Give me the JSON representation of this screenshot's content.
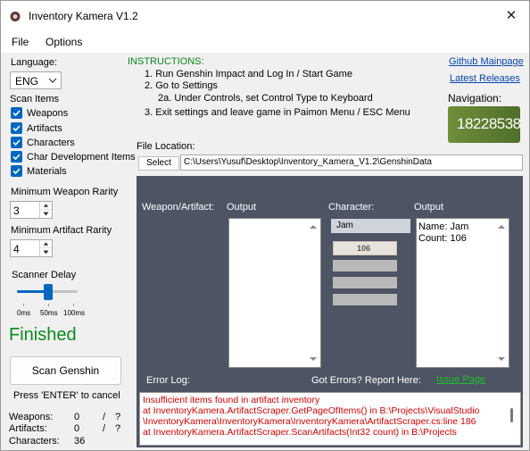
{
  "window": {
    "title": "Inventory Kamera V1.2",
    "close_symbol": "✕"
  },
  "menu": {
    "file": "File",
    "options": "Options"
  },
  "language": {
    "label": "Language:",
    "value": "ENG"
  },
  "scan_items": {
    "label": "Scan Items",
    "items": [
      {
        "label": "Weapons",
        "checked": true
      },
      {
        "label": "Artifacts",
        "checked": true
      },
      {
        "label": "Characters",
        "checked": true
      },
      {
        "label": "Char Development Items",
        "checked": true
      },
      {
        "label": "Materials",
        "checked": true
      }
    ]
  },
  "min_weapon_rarity": {
    "label": "Minimum Weapon Rarity",
    "value": "3"
  },
  "min_artifact_rarity": {
    "label": "Minimum Artifact Rarity",
    "value": "4"
  },
  "scanner_delay": {
    "label": "Scanner Delay",
    "ticks": [
      "0ms",
      "50ms",
      "100ms"
    ],
    "value_fraction": 0.5
  },
  "status": {
    "text": "Finished",
    "color": "#0a8a1e"
  },
  "scan_button": {
    "label": "Scan Genshin"
  },
  "cancel_hint": "Press 'ENTER' to cancel",
  "counts": {
    "weapons": {
      "label": "Weapons:",
      "value": "0",
      "sep": "/",
      "total": "?"
    },
    "artifacts": {
      "label": "Artifacts:",
      "value": "0",
      "sep": "/",
      "total": "?"
    },
    "characters": {
      "label": "Characters:",
      "value": "36"
    }
  },
  "instructions": {
    "title": "INSTRUCTIONS:",
    "lines": [
      "1. Run Genshin Impact and Log In / Start Game",
      "2. Go to Settings",
      "2a. Under Controls, set Control Type to Keyboard",
      "3. Exit settings and leave game in Paimon Menu / ESC Menu"
    ]
  },
  "links": {
    "github": "Github Mainpage",
    "releases": "Latest Releases"
  },
  "navigation": {
    "label": "Navigation:",
    "badge_text": "18228538"
  },
  "file_location": {
    "label": "File Location:",
    "select_label": "Select",
    "path": "C:\\Users\\Yusuf\\Desktop\\Inventory_Kamera_V1.2\\GenshinData"
  },
  "panel": {
    "weapon_artifact_label": "Weapon/Artifact:",
    "output_label_left": "Output",
    "character_label": "Character:",
    "output_label_right": "Output",
    "char_preview_name": "Jam",
    "char_preview_level": "106",
    "output_right_lines": [
      "Name: Jam",
      "Count: 106"
    ],
    "error_log_label": "Error Log:",
    "report_label": "Got Errors? Report Here:",
    "issue_link": "Issue Page"
  },
  "error_log": {
    "lines": [
      "Insufficient items found in artifact inventory",
      "   at InventoryKamera.ArtifactScraper.GetPageOfItems() in B:\\Projects\\VisualStudio",
      "\\InventoryKamera\\InventoryKamera\\InventoryKamera\\ArtifactScraper.cs:line 186",
      "   at InventoryKamera.ArtifactScraper.ScanArtifacts(Int32 count) in B:\\Projects"
    ],
    "color": "#d40000"
  }
}
